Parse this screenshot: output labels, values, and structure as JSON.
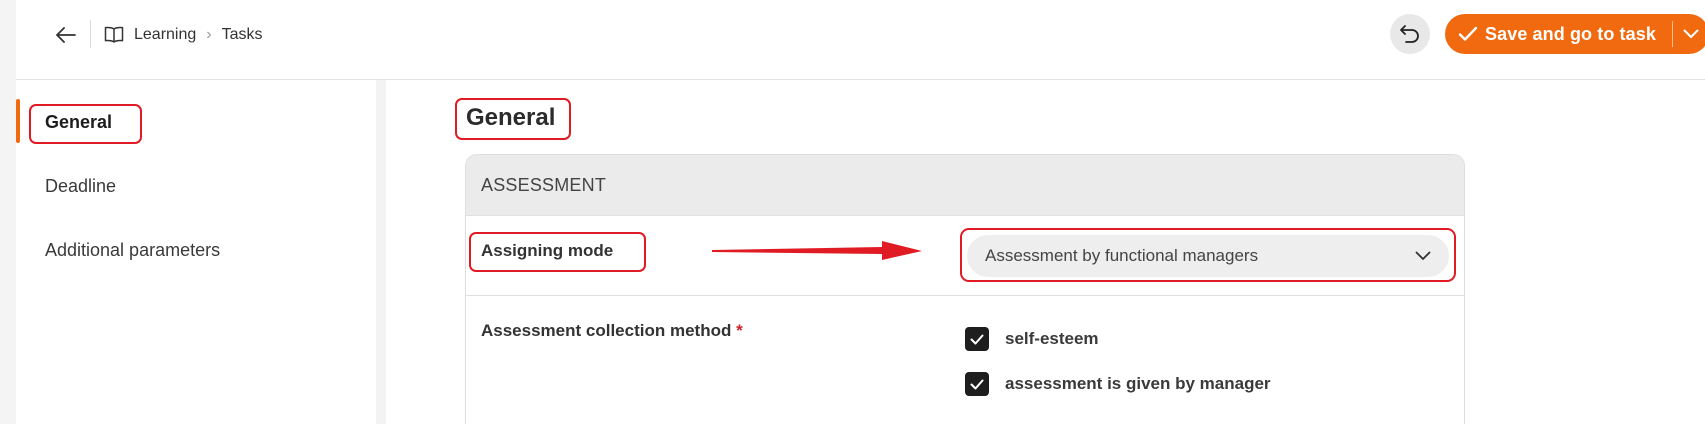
{
  "header": {
    "breadcrumb": [
      "Learning",
      "Tasks"
    ],
    "breadcrumb_separator": "›",
    "save_label": "Save and go to task"
  },
  "sidebar": {
    "items": [
      {
        "label": "General",
        "active": true
      },
      {
        "label": "Deadline",
        "active": false
      },
      {
        "label": "Additional parameters",
        "active": false
      }
    ]
  },
  "main": {
    "title": "General",
    "section_header": "ASSESSMENT",
    "assigning_mode": {
      "label": "Assigning mode",
      "value": "Assessment by functional managers"
    },
    "collection_method": {
      "label": "Assessment collection method",
      "required_mark": "*",
      "options": [
        {
          "label": "self-esteem",
          "checked": true
        },
        {
          "label": "assessment is given by manager",
          "checked": true
        }
      ]
    }
  },
  "colors": {
    "accent": "#f26a0f",
    "annotation": "#e01b24"
  }
}
